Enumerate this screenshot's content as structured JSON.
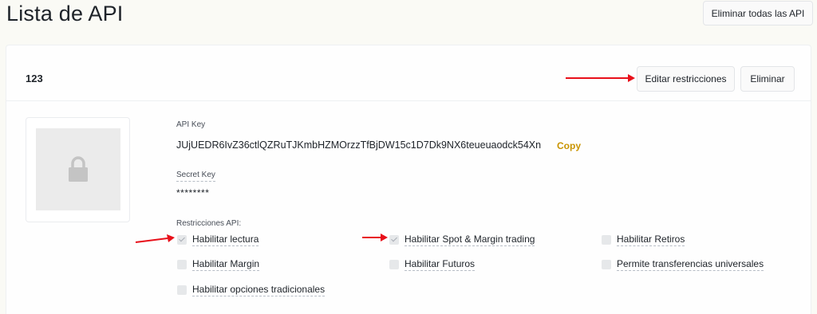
{
  "page": {
    "title": "Lista de API",
    "delete_all_label": "Eliminar todas las API"
  },
  "api": {
    "name": "123",
    "edit_label": "Editar restricciones",
    "delete_label": "Eliminar",
    "api_key_label": "API Key",
    "api_key_value": "JUjUEDR6IvZ36ctlQZRuTJKmbHZMOrzzTfBjDW15c1D7Dk9NX6teueuaodck54Xn",
    "copy_label": "Copy",
    "secret_key_label": "Secret Key",
    "secret_key_value": "********",
    "restrictions_label": "Restricciones API:",
    "restrictions": [
      {
        "label": "Habilitar lectura",
        "checked": true
      },
      {
        "label": "Habilitar Spot & Margin trading",
        "checked": true
      },
      {
        "label": "Habilitar Retiros",
        "checked": false
      },
      {
        "label": "Habilitar Margin",
        "checked": false
      },
      {
        "label": "Habilitar Futuros",
        "checked": false
      },
      {
        "label": "Permite transferencias universales",
        "checked": false
      },
      {
        "label": "Habilitar opciones tradicionales",
        "checked": false
      }
    ]
  },
  "icons": {
    "thumbnail": "lock-icon",
    "checkbox_checked": "checkmark-icon",
    "annotation": "red-arrow-icon"
  },
  "colors": {
    "accent": "#c99400",
    "arrow": "#e8101a",
    "background": "#fafaf5"
  }
}
